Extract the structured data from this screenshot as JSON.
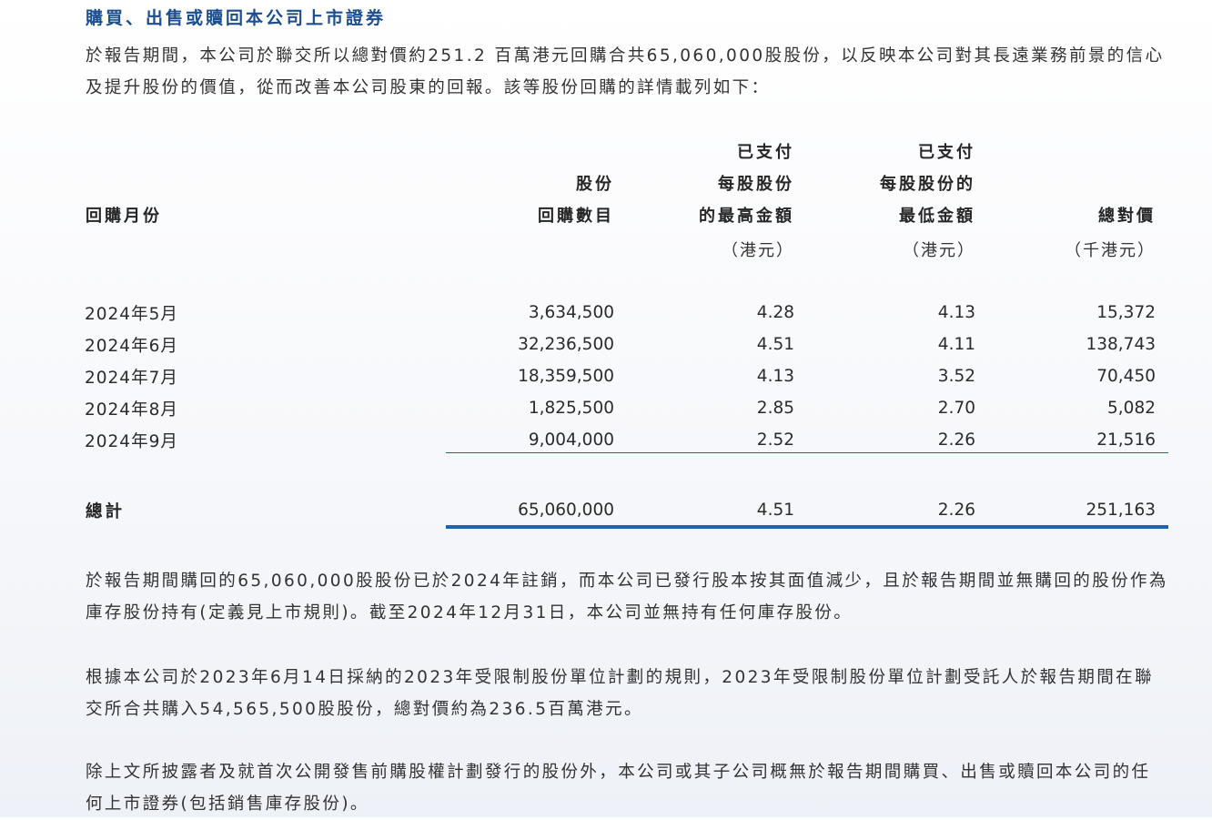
{
  "heading": "購買、出售或贖回本公司上市證券",
  "intro": "於報告期間，本公司於聯交所以總對價約251.2 百萬港元回購合共65,060,000股股份，以反映本公司對其長遠業務前景的信心及提升股份的價值，從而改善本公司股東的回報。該等股份回購的詳情載列如下：",
  "table": {
    "headers": {
      "month": "回購月份",
      "shares_line1": "股份",
      "shares_line2": "回購數目",
      "high_line1": "已支付",
      "high_line2": "每股股份",
      "high_line3": "的最高金額",
      "high_unit": "（港元）",
      "low_line1": "已支付",
      "low_line2": "每股股份的",
      "low_line3": "最低金額",
      "low_unit": "（港元）",
      "total_line1": "總對價",
      "total_unit": "（千港元）"
    },
    "rows": [
      {
        "month": "2024年5月",
        "shares": "3,634,500",
        "high": "4.28",
        "low": "4.13",
        "total": "15,372"
      },
      {
        "month": "2024年6月",
        "shares": "32,236,500",
        "high": "4.51",
        "low": "4.11",
        "total": "138,743"
      },
      {
        "month": "2024年7月",
        "shares": "18,359,500",
        "high": "4.13",
        "low": "3.52",
        "total": "70,450"
      },
      {
        "month": "2024年8月",
        "shares": "1,825,500",
        "high": "2.85",
        "low": "2.70",
        "total": "5,082"
      },
      {
        "month": "2024年9月",
        "shares": "9,004,000",
        "high": "2.52",
        "low": "2.26",
        "total": "21,516"
      }
    ],
    "total_row": {
      "label": "總計",
      "shares": "65,060,000",
      "high": "4.51",
      "low": "2.26",
      "total": "251,163"
    }
  },
  "note1": "於報告期間購回的65,060,000股股份已於2024年註銷，而本公司已發行股本按其面值減少，且於報告期間並無購回的股份作為庫存股份持有(定義見上市規則)。截至2024年12月31日，本公司並無持有任何庫存股份。",
  "note2": "根據本公司於2023年6月14日採納的2023年受限制股份單位計劃的規則，2023年受限制股份單位計劃受託人於報告期間在聯交所合共購入54,565,500股股份，總對價約為236.5百萬港元。",
  "note3": "除上文所披露者及就首次公開發售前購股權計劃發行的股份外，本公司或其子公司概無於報告期間購買、出售或贖回本公司的任何上市證券(包括銷售庫存股份)。"
}
